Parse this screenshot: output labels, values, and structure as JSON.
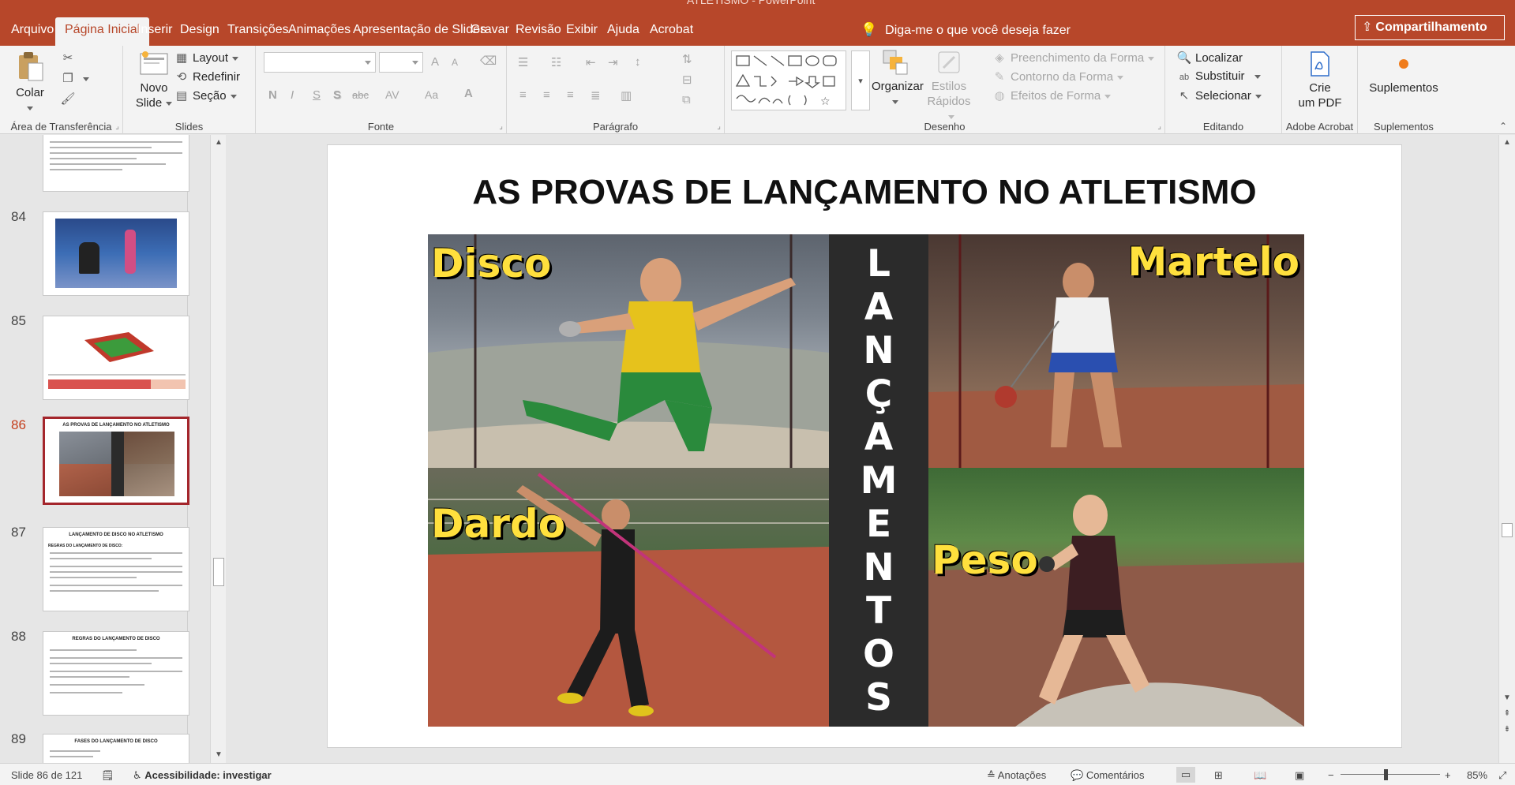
{
  "app": {
    "window_title": "ATLETISMO - PowerPoint",
    "tabs": [
      "Arquivo",
      "Página Inicial",
      "Inserir",
      "Design",
      "Transições",
      "Animações",
      "Apresentação de Slides",
      "Gravar",
      "Revisão",
      "Exibir",
      "Ajuda",
      "Acrobat"
    ],
    "active_tab": "Página Inicial",
    "tell_me": "Diga-me o que você deseja fazer",
    "share": "Compartilhamento",
    "accent_color": "#b7472a"
  },
  "ribbon": {
    "clipboard": {
      "label": "Área de Transferência",
      "paste": "Colar"
    },
    "slides": {
      "label": "Slides",
      "new_slide_1": "Novo",
      "new_slide_2": "Slide",
      "layout": "Layout",
      "reset": "Redefinir",
      "section": "Seção"
    },
    "font": {
      "label": "Fonte",
      "bold": "N",
      "italic": "I",
      "underline": "S",
      "shadow": "S",
      "strike": "abc",
      "spacing": "AV",
      "case": "Aa",
      "color": "A",
      "grow": "A",
      "shrink": "A"
    },
    "paragraph": {
      "label": "Parágrafo"
    },
    "drawing": {
      "label": "Desenho",
      "arrange": "Organizar",
      "quick_styles_1": "Estilos",
      "quick_styles_2": "Rápidos",
      "shape_fill": "Preenchimento da Forma",
      "shape_outline": "Contorno da Forma",
      "shape_effects": "Efeitos de Forma"
    },
    "editing": {
      "label": "Editando",
      "find": "Localizar",
      "replace": "Substituir",
      "select": "Selecionar"
    },
    "acrobat": {
      "label": "Adobe Acrobat",
      "create_pdf_1": "Crie",
      "create_pdf_2": "um PDF"
    },
    "addins": {
      "label": "Suplementos",
      "button": "Suplementos"
    }
  },
  "thumbnails": [
    {
      "num": "84",
      "title": ""
    },
    {
      "num": "85",
      "title": ""
    },
    {
      "num": "86",
      "title": "AS PROVAS DE LANÇAMENTO NO ATLETISMO",
      "active": true
    },
    {
      "num": "87",
      "title": "LANÇAMENTO DE DISCO NO ATLETISMO",
      "subtitle": "REGRAS DO LANÇAMENTO DE DISCO:"
    },
    {
      "num": "88",
      "title": "REGRAS DO LANÇAMENTO DE DISCO"
    },
    {
      "num": "89",
      "title": "FASES DO LANÇAMENTO DE DISCO"
    }
  ],
  "slide": {
    "title": "AS PROVAS DE LANÇAMENTO NO ATLETISMO",
    "labels": {
      "disco": "Disco",
      "martelo": "Martelo",
      "dardo": "Dardo",
      "peso": "Peso"
    },
    "vertical_word": [
      "L",
      "A",
      "N",
      "Ç",
      "A",
      "M",
      "E",
      "N",
      "T",
      "O",
      "S"
    ]
  },
  "status": {
    "slide_count": "Slide 86 de 121",
    "accessibility": "Acessibilidade: investigar",
    "notes": "Anotações",
    "comments": "Comentários",
    "zoom": "85%",
    "zoom_level": 0.45
  }
}
